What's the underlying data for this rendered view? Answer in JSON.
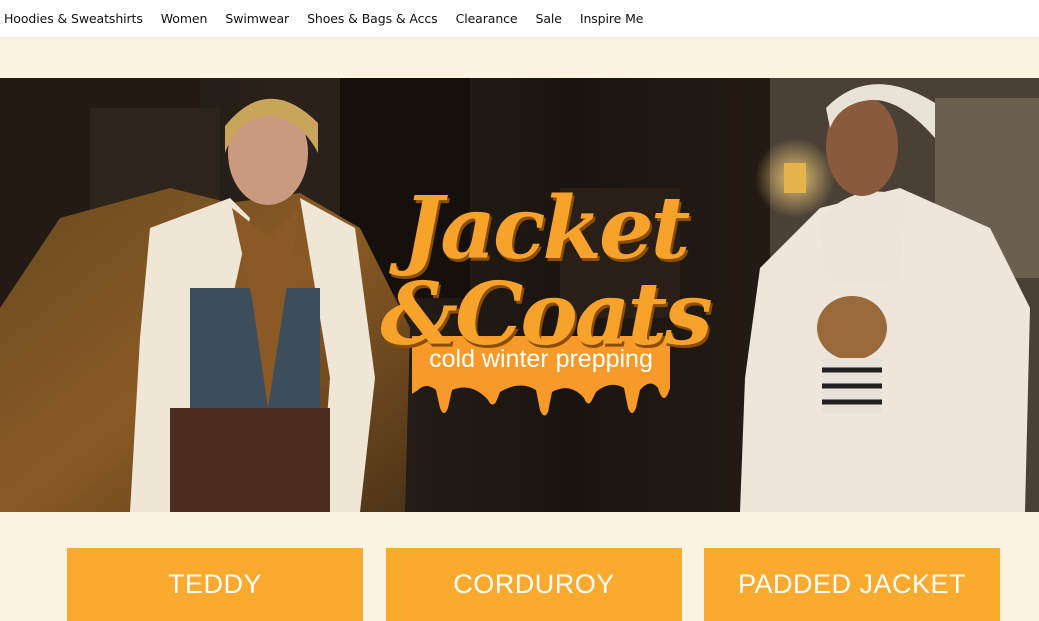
{
  "nav": {
    "items": [
      {
        "label": "Hoodies & Sweatshirts"
      },
      {
        "label": "Women"
      },
      {
        "label": "Swimwear"
      },
      {
        "label": "Shoes & Bags & Accs"
      },
      {
        "label": "Clearance"
      },
      {
        "label": "Sale"
      },
      {
        "label": "Inspire Me"
      }
    ]
  },
  "hero": {
    "title": "Jacket &Coats",
    "subtitle": "cold winter prepping",
    "title_color": "#f7a22b",
    "badge_color": "#f79a2a"
  },
  "categories": [
    {
      "label": "TEDDY"
    },
    {
      "label": "CORDUROY"
    },
    {
      "label": "PADDED JACKET"
    }
  ],
  "colors": {
    "page_bg": "#fdf3e3",
    "category_bg": "#faaa2f"
  }
}
